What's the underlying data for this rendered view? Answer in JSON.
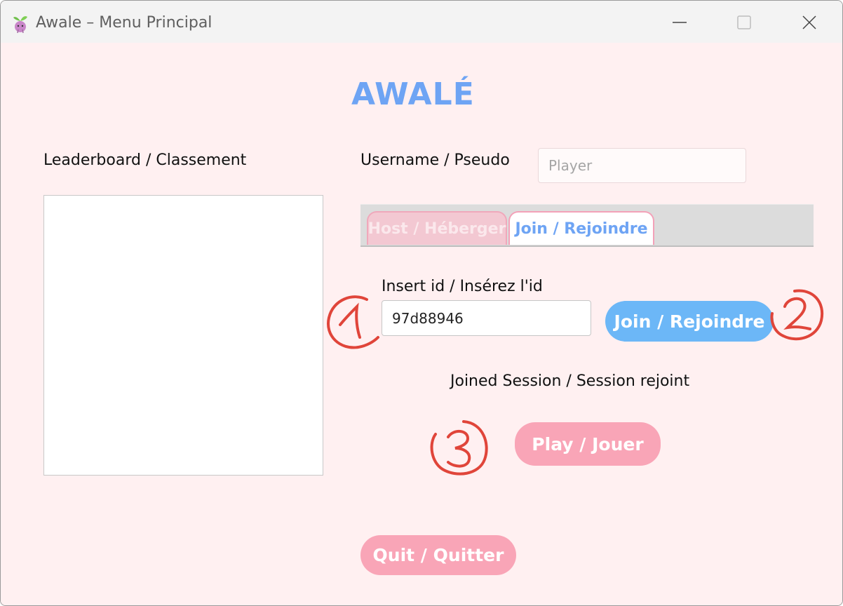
{
  "window": {
    "title": "Awale – Menu Principal"
  },
  "app": {
    "title": "AWALÉ"
  },
  "leaderboard": {
    "label": "Leaderboard / Classement"
  },
  "username": {
    "label": "Username / Pseudo",
    "placeholder": "Player",
    "value": ""
  },
  "tabs": [
    {
      "label": "Host / Héberger",
      "selected": false
    },
    {
      "label": "Join / Rejoindre",
      "selected": true
    }
  ],
  "join": {
    "id_label": "Insert id / Insérez l'id",
    "id_value": "97d88946",
    "button_label": "Join / Rejoindre",
    "status": "Joined Session / Session rejoint"
  },
  "play": {
    "button_label": "Play / Jouer"
  },
  "quit": {
    "button_label": "Quit / Quitter"
  },
  "annotations": [
    "1",
    "2",
    "3"
  ],
  "colors": {
    "accent_blue": "#6ea4f4",
    "join_button": "#6cb7f7",
    "pink_button": "#f9a5b7",
    "background": "#fff0f1",
    "annotation_red": "#e0453a"
  }
}
